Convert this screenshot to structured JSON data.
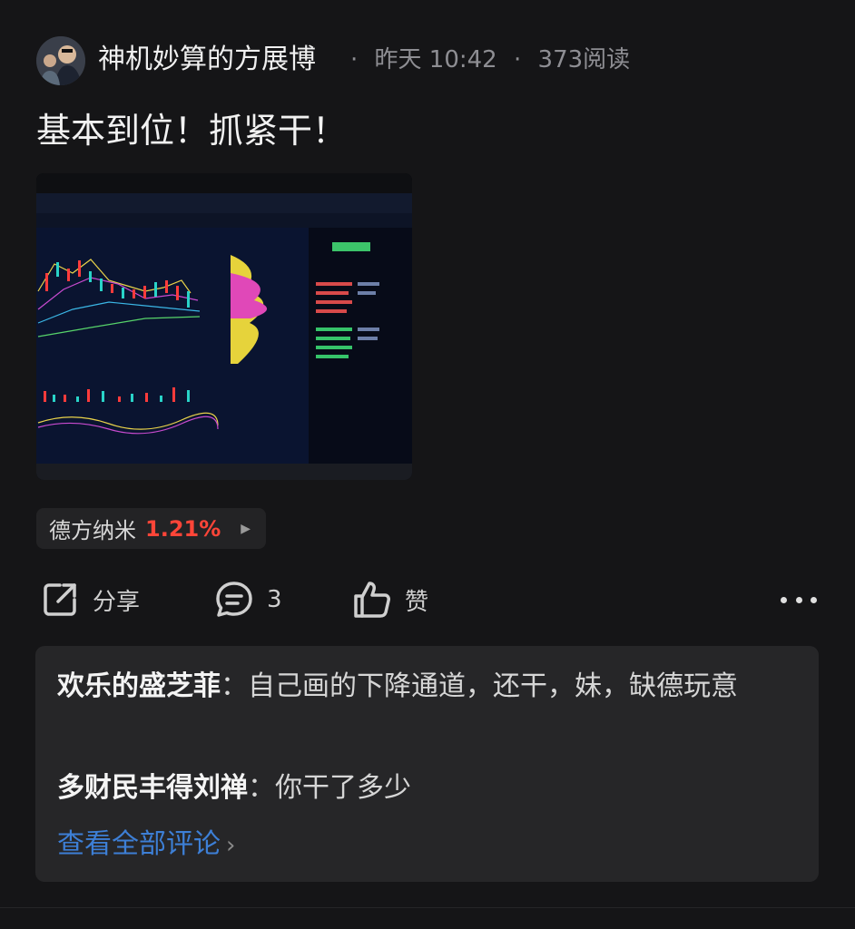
{
  "post": {
    "author": "神机妙算的方展博",
    "time": "昨天 10:42",
    "reads": "373阅读",
    "separator": "·",
    "text": "基本到位！抓紧干！",
    "image_alt": "股票行情截图"
  },
  "stock": {
    "name": "德方纳米",
    "change": "1.21%",
    "change_color": "#ff4538"
  },
  "actions": {
    "share_label": "分享",
    "comment_count": "3",
    "like_label": "赞"
  },
  "comments": [
    {
      "user": "欢乐的盛芝菲",
      "sep": "：",
      "text": "自己画的下降通道，还干，妹，缺德玩意"
    },
    {
      "user": "多财民丰得刘禅",
      "sep": "：",
      "text": "你干了多少"
    }
  ],
  "view_all_label": "查看全部评论",
  "icons": [
    "avatar",
    "share-icon",
    "comment-icon",
    "like-icon",
    "more-icon",
    "chevron-right-icon",
    "play-arrow-icon"
  ],
  "colors": {
    "background": "#151517",
    "accent_link": "#3d7fd6",
    "up_red": "#ff4538"
  }
}
